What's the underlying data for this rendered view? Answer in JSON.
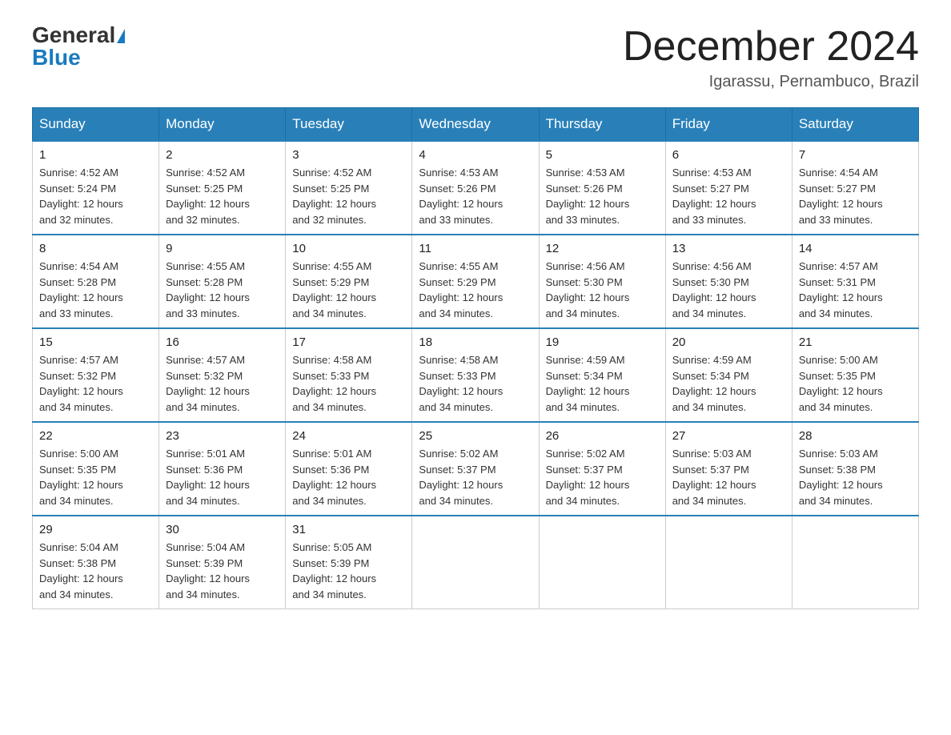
{
  "header": {
    "logo_general": "General",
    "logo_blue": "Blue",
    "month_title": "December 2024",
    "location": "Igarassu, Pernambuco, Brazil"
  },
  "days_of_week": [
    "Sunday",
    "Monday",
    "Tuesday",
    "Wednesday",
    "Thursday",
    "Friday",
    "Saturday"
  ],
  "weeks": [
    [
      {
        "day": "1",
        "sunrise": "4:52 AM",
        "sunset": "5:24 PM",
        "daylight": "12 hours and 32 minutes."
      },
      {
        "day": "2",
        "sunrise": "4:52 AM",
        "sunset": "5:25 PM",
        "daylight": "12 hours and 32 minutes."
      },
      {
        "day": "3",
        "sunrise": "4:52 AM",
        "sunset": "5:25 PM",
        "daylight": "12 hours and 32 minutes."
      },
      {
        "day": "4",
        "sunrise": "4:53 AM",
        "sunset": "5:26 PM",
        "daylight": "12 hours and 33 minutes."
      },
      {
        "day": "5",
        "sunrise": "4:53 AM",
        "sunset": "5:26 PM",
        "daylight": "12 hours and 33 minutes."
      },
      {
        "day": "6",
        "sunrise": "4:53 AM",
        "sunset": "5:27 PM",
        "daylight": "12 hours and 33 minutes."
      },
      {
        "day": "7",
        "sunrise": "4:54 AM",
        "sunset": "5:27 PM",
        "daylight": "12 hours and 33 minutes."
      }
    ],
    [
      {
        "day": "8",
        "sunrise": "4:54 AM",
        "sunset": "5:28 PM",
        "daylight": "12 hours and 33 minutes."
      },
      {
        "day": "9",
        "sunrise": "4:55 AM",
        "sunset": "5:28 PM",
        "daylight": "12 hours and 33 minutes."
      },
      {
        "day": "10",
        "sunrise": "4:55 AM",
        "sunset": "5:29 PM",
        "daylight": "12 hours and 34 minutes."
      },
      {
        "day": "11",
        "sunrise": "4:55 AM",
        "sunset": "5:29 PM",
        "daylight": "12 hours and 34 minutes."
      },
      {
        "day": "12",
        "sunrise": "4:56 AM",
        "sunset": "5:30 PM",
        "daylight": "12 hours and 34 minutes."
      },
      {
        "day": "13",
        "sunrise": "4:56 AM",
        "sunset": "5:30 PM",
        "daylight": "12 hours and 34 minutes."
      },
      {
        "day": "14",
        "sunrise": "4:57 AM",
        "sunset": "5:31 PM",
        "daylight": "12 hours and 34 minutes."
      }
    ],
    [
      {
        "day": "15",
        "sunrise": "4:57 AM",
        "sunset": "5:32 PM",
        "daylight": "12 hours and 34 minutes."
      },
      {
        "day": "16",
        "sunrise": "4:57 AM",
        "sunset": "5:32 PM",
        "daylight": "12 hours and 34 minutes."
      },
      {
        "day": "17",
        "sunrise": "4:58 AM",
        "sunset": "5:33 PM",
        "daylight": "12 hours and 34 minutes."
      },
      {
        "day": "18",
        "sunrise": "4:58 AM",
        "sunset": "5:33 PM",
        "daylight": "12 hours and 34 minutes."
      },
      {
        "day": "19",
        "sunrise": "4:59 AM",
        "sunset": "5:34 PM",
        "daylight": "12 hours and 34 minutes."
      },
      {
        "day": "20",
        "sunrise": "4:59 AM",
        "sunset": "5:34 PM",
        "daylight": "12 hours and 34 minutes."
      },
      {
        "day": "21",
        "sunrise": "5:00 AM",
        "sunset": "5:35 PM",
        "daylight": "12 hours and 34 minutes."
      }
    ],
    [
      {
        "day": "22",
        "sunrise": "5:00 AM",
        "sunset": "5:35 PM",
        "daylight": "12 hours and 34 minutes."
      },
      {
        "day": "23",
        "sunrise": "5:01 AM",
        "sunset": "5:36 PM",
        "daylight": "12 hours and 34 minutes."
      },
      {
        "day": "24",
        "sunrise": "5:01 AM",
        "sunset": "5:36 PM",
        "daylight": "12 hours and 34 minutes."
      },
      {
        "day": "25",
        "sunrise": "5:02 AM",
        "sunset": "5:37 PM",
        "daylight": "12 hours and 34 minutes."
      },
      {
        "day": "26",
        "sunrise": "5:02 AM",
        "sunset": "5:37 PM",
        "daylight": "12 hours and 34 minutes."
      },
      {
        "day": "27",
        "sunrise": "5:03 AM",
        "sunset": "5:37 PM",
        "daylight": "12 hours and 34 minutes."
      },
      {
        "day": "28",
        "sunrise": "5:03 AM",
        "sunset": "5:38 PM",
        "daylight": "12 hours and 34 minutes."
      }
    ],
    [
      {
        "day": "29",
        "sunrise": "5:04 AM",
        "sunset": "5:38 PM",
        "daylight": "12 hours and 34 minutes."
      },
      {
        "day": "30",
        "sunrise": "5:04 AM",
        "sunset": "5:39 PM",
        "daylight": "12 hours and 34 minutes."
      },
      {
        "day": "31",
        "sunrise": "5:05 AM",
        "sunset": "5:39 PM",
        "daylight": "12 hours and 34 minutes."
      },
      null,
      null,
      null,
      null
    ]
  ],
  "labels": {
    "sunrise": "Sunrise:",
    "sunset": "Sunset:",
    "daylight": "Daylight:"
  }
}
